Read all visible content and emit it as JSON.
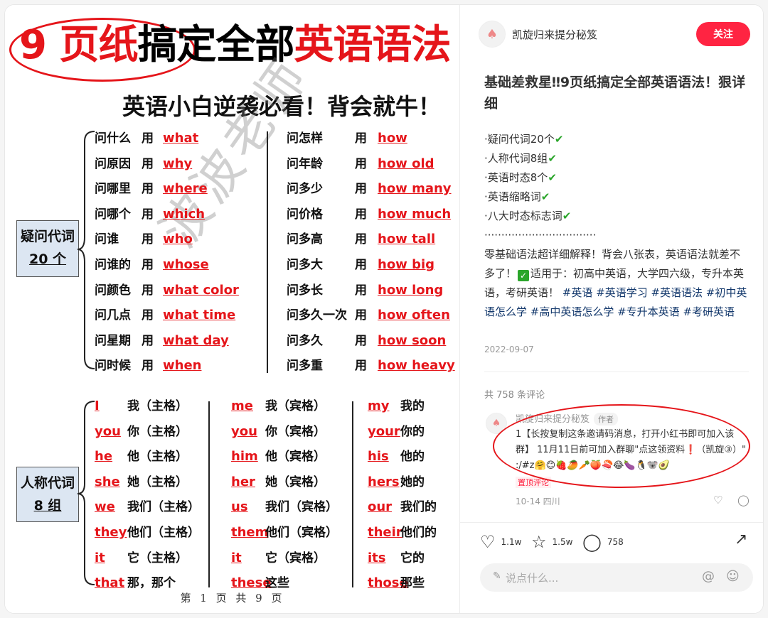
{
  "image": {
    "title_part1": "9 页纸",
    "title_part2": "搞定全部",
    "title_part3": "英语语法",
    "subtitle": "英语小白逆袭必看！背会就牛！",
    "watermark": "波波老师",
    "section1": {
      "label_line1": "疑问代词",
      "label_line2": "20 个",
      "left_rows": [
        {
          "cn": "问什么",
          "v": "用",
          "en": "what"
        },
        {
          "cn": "问原因",
          "v": "用",
          "en": "why"
        },
        {
          "cn": "问哪里",
          "v": "用",
          "en": "where"
        },
        {
          "cn": "问哪个",
          "v": "用",
          "en": "which"
        },
        {
          "cn": "问谁",
          "v": "用",
          "en": "who"
        },
        {
          "cn": "问谁的",
          "v": "用",
          "en": "whose"
        },
        {
          "cn": "问颜色",
          "v": "用",
          "en": "what color"
        },
        {
          "cn": "问几点",
          "v": "用",
          "en": "what time"
        },
        {
          "cn": "问星期",
          "v": "用",
          "en": "what day"
        },
        {
          "cn": "问时候",
          "v": "用",
          "en": "when"
        }
      ],
      "right_rows": [
        {
          "cn": "问怎样",
          "v": "用",
          "en": "how"
        },
        {
          "cn": "问年龄",
          "v": "用",
          "en": "how old"
        },
        {
          "cn": "问多少",
          "v": "用",
          "en": "how many"
        },
        {
          "cn": "问价格",
          "v": "用",
          "en": "how much"
        },
        {
          "cn": "问多高",
          "v": "用",
          "en": "how tall"
        },
        {
          "cn": "问多大",
          "v": "用",
          "en": "how big"
        },
        {
          "cn": "问多长",
          "v": "用",
          "en": "how long"
        },
        {
          "cn": "问多久一次",
          "v": "用",
          "en": "how often"
        },
        {
          "cn": "问多久",
          "v": "用",
          "en": "how soon"
        },
        {
          "cn": "问多重",
          "v": "用",
          "en": "how heavy"
        }
      ]
    },
    "section2": {
      "label_line1": "人称代词",
      "label_line2": "8 组",
      "col1": [
        {
          "en": "I",
          "cn": "我（主格）"
        },
        {
          "en": "you",
          "cn": "你（主格）"
        },
        {
          "en": "he",
          "cn": "他（主格）"
        },
        {
          "en": "she",
          "cn": "她（主格）"
        },
        {
          "en": "we",
          "cn": "我们（主格）"
        },
        {
          "en": "they",
          "cn": "他们（主格）"
        },
        {
          "en": "it",
          "cn": "它（主格）"
        },
        {
          "en": "that",
          "cn": "那，那个"
        }
      ],
      "col2": [
        {
          "en": "me",
          "cn": "我（宾格）"
        },
        {
          "en": "you",
          "cn": "你（宾格）"
        },
        {
          "en": "him",
          "cn": "他（宾格）"
        },
        {
          "en": "her",
          "cn": "她（宾格）"
        },
        {
          "en": "us",
          "cn": "我们（宾格）"
        },
        {
          "en": "them",
          "cn": "他们（宾格）"
        },
        {
          "en": "it",
          "cn": "它（宾格）"
        },
        {
          "en": "these",
          "cn": "这些"
        }
      ],
      "col3": [
        {
          "en": "my",
          "cn": "我的"
        },
        {
          "en": "your",
          "cn": "你的"
        },
        {
          "en": "his",
          "cn": "他的"
        },
        {
          "en": "hers",
          "cn": "她的"
        },
        {
          "en": "our",
          "cn": "我们的"
        },
        {
          "en": "their",
          "cn": "他们的"
        },
        {
          "en": "its",
          "cn": "它的"
        },
        {
          "en": "those",
          "cn": "那些"
        }
      ]
    },
    "footer": "第 1 页 共 9 页"
  },
  "note": {
    "author": "凯旋归来提分秘笈",
    "follow_label": "关注",
    "title": "基础差救星‼9页纸搞定全部英语语法！狠详细",
    "bullets": [
      "·疑问代词20个",
      "·人称代词8组",
      "·英语时态8个",
      "·英语缩略词",
      "·八大时态标志词"
    ],
    "check_glyph": "✔",
    "dots": "·································",
    "para": "零基础语法超详细解释！背会八张表，英语语法就差不多了！",
    "para2": "适用于：初高中英语，大学四六级，专升本英语，考研英语！",
    "tags": "#英语 #英语学习 #英语语法 #初中英语怎么学 #高中英语怎么学 #专升本英语 #考研英语",
    "date": "2022-09-07"
  },
  "comments": {
    "count_label": "共 758 条评论",
    "first": {
      "name": "凯旋归来提分秘笈",
      "badge": "作者",
      "text": "1【长按复制这条邀请码消息，打开小红书即可加入该群】 11月11日前可加入群聊\"点这领资料❗（凯旋③）\" :/#z🤗😊🍓🥭🥕🍑🍣😂🍆🐧🐨🥑",
      "pinned": "置顶评论",
      "meta": "10-14 四川"
    }
  },
  "actions": {
    "likes": "1.1w",
    "collects": "1.5w",
    "comments": "758",
    "input_placeholder": "说点什么..."
  },
  "colors": {
    "accent": "#ff2442",
    "highlight": "#e5151a",
    "label_box": "#dce6f2"
  }
}
